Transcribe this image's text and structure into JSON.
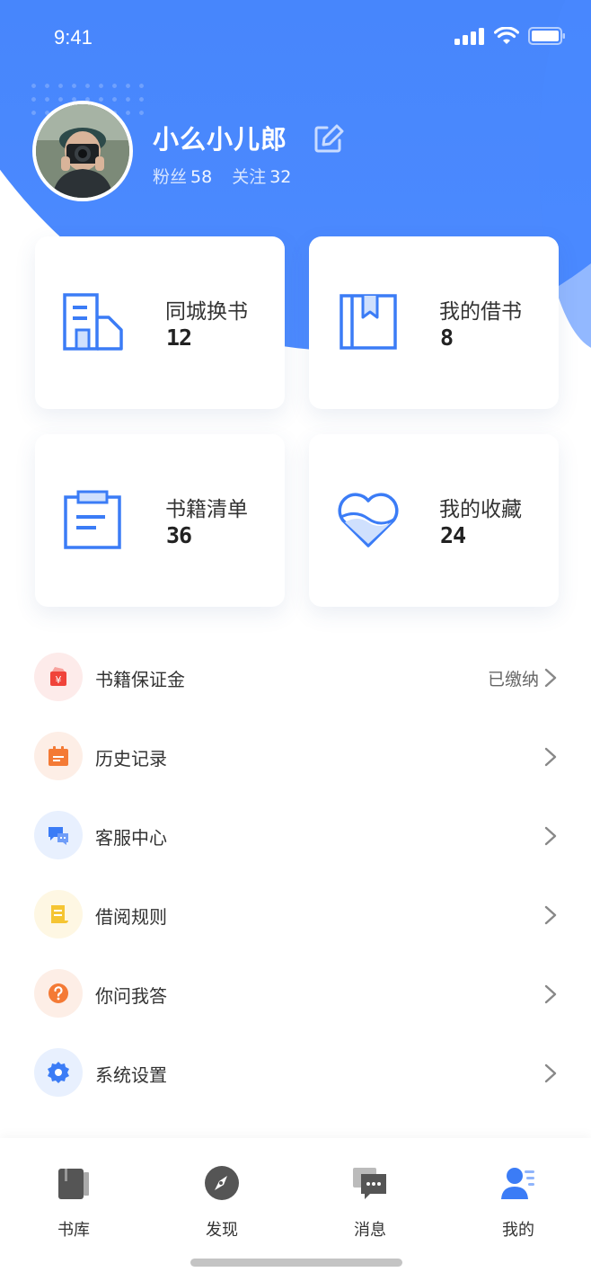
{
  "status": {
    "time": "9:41"
  },
  "profile": {
    "name": "小么小儿郎",
    "fans_label": "粉丝",
    "fans_count": "58",
    "follow_label": "关注",
    "follow_count": "32"
  },
  "cards": [
    {
      "title": "同城换书",
      "count": "12",
      "icon": "building-icon"
    },
    {
      "title": "我的借书",
      "count": "8",
      "icon": "book-icon"
    },
    {
      "title": "书籍清单",
      "count": "36",
      "icon": "clipboard-icon"
    },
    {
      "title": "我的收藏",
      "count": "24",
      "icon": "heart-icon"
    }
  ],
  "menu": [
    {
      "label": "书籍保证金",
      "value": "已缴纳",
      "icon": "deposit-icon",
      "color": "#f0433a",
      "bg": "#fdebea"
    },
    {
      "label": "历史记录",
      "value": "",
      "icon": "calendar-icon",
      "color": "#f47a35",
      "bg": "#fdeee6"
    },
    {
      "label": "客服中心",
      "value": "",
      "icon": "chat-icon",
      "color": "#3b7cf6",
      "bg": "#e8f0fe"
    },
    {
      "label": "借阅规则",
      "value": "",
      "icon": "scroll-icon",
      "color": "#f5c533",
      "bg": "#fef7e3"
    },
    {
      "label": "你问我答",
      "value": "",
      "icon": "question-icon",
      "color": "#f47a35",
      "bg": "#fdeee6"
    },
    {
      "label": "系统设置",
      "value": "",
      "icon": "gear-icon",
      "color": "#3b7cf6",
      "bg": "#e8f0fe"
    }
  ],
  "tabs": [
    {
      "label": "书库",
      "icon": "library-icon"
    },
    {
      "label": "发现",
      "icon": "compass-icon"
    },
    {
      "label": "消息",
      "icon": "message-icon"
    },
    {
      "label": "我的",
      "icon": "profile-icon"
    }
  ],
  "colors": {
    "primary": "#3b7cf6",
    "tab_active": "#3b7cf6",
    "tab_inactive": "#555555"
  }
}
